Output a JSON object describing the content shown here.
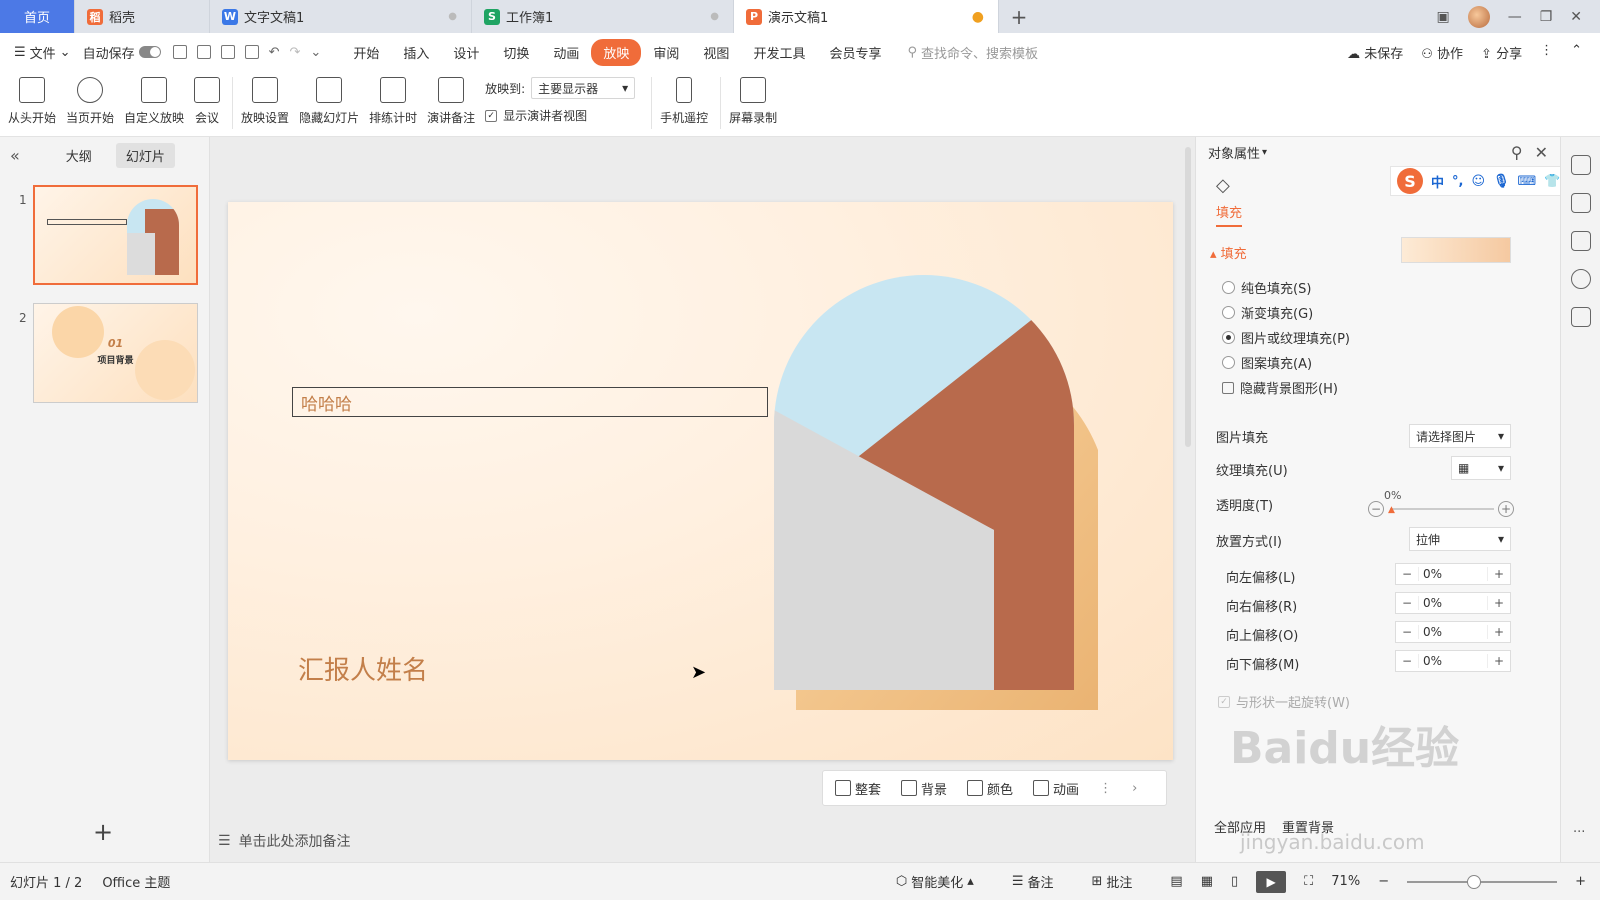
{
  "tabs": [
    {
      "label": "首页",
      "icon": "home"
    },
    {
      "label": "稻壳",
      "icon": "daoke-icon",
      "color": "#f06c3a"
    },
    {
      "label": "文字文稿1",
      "icon": "writer-icon",
      "color": "#3b78e7"
    },
    {
      "label": "工作簿1",
      "icon": "sheet-icon",
      "color": "#1fa463"
    },
    {
      "label": "演示文稿1",
      "icon": "presentation-icon",
      "color": "#f06c3a"
    }
  ],
  "menubar": {
    "file": "文件",
    "autosave": "自动保存",
    "tabs": [
      "开始",
      "插入",
      "设计",
      "切换",
      "动画",
      "放映",
      "审阅",
      "视图",
      "开发工具",
      "会员专享"
    ],
    "active_tab": "放映",
    "search_placeholder": "查找命令、搜索模板",
    "unsaved": "未保存",
    "collab": "协作",
    "share": "分享"
  },
  "ribbon": {
    "from_start": "从头开始",
    "from_current": "当页开始",
    "custom_show": "自定义放映",
    "meeting": "会议",
    "show_settings": "放映设置",
    "hide_slide": "隐藏幻灯片",
    "rehearse": "排练计时",
    "speaker_notes": "演讲备注",
    "play_to_label": "放映到:",
    "play_to_value": "主要显示器",
    "presenter_view": "显示演讲者视图",
    "phone_remote": "手机遥控",
    "screen_record": "屏幕录制"
  },
  "left_panel": {
    "tab_outline": "大纲",
    "tab_slides": "幻灯片",
    "slide_numbers": [
      "1",
      "2"
    ],
    "slide2_num": "01",
    "slide2_title": "项目背景"
  },
  "slide": {
    "title_text": "哈哈哈",
    "reporter": "汇报人姓名"
  },
  "float_toolbar": {
    "design": "整套",
    "background": "背景",
    "color": "颜色",
    "animation": "动画"
  },
  "notes_placeholder": "单击此处添加备注",
  "right_panel": {
    "title": "对象属性",
    "fill_tab": "填充",
    "section": "填充",
    "options": [
      {
        "label": "纯色填充(S)",
        "checked": false
      },
      {
        "label": "渐变填充(G)",
        "checked": false
      },
      {
        "label": "图片或纹理填充(P)",
        "checked": true
      },
      {
        "label": "图案填充(A)",
        "checked": false
      }
    ],
    "hide_bg": "隐藏背景图形(H)",
    "picture_fill_label": "图片填充",
    "picture_fill_value": "请选择图片",
    "texture_fill_label": "纹理填充(U)",
    "transparency_label": "透明度(T)",
    "transparency_value": "0%",
    "placement_label": "放置方式(I)",
    "placement_value": "拉伸",
    "offsets": [
      {
        "label": "向左偏移(L)",
        "value": "0%"
      },
      {
        "label": "向右偏移(R)",
        "value": "0%"
      },
      {
        "label": "向上偏移(O)",
        "value": "0%"
      },
      {
        "label": "向下偏移(M)",
        "value": "0%"
      }
    ],
    "rotate_with_shape": "与形状一起旋转(W)",
    "apply_all": "全部应用",
    "reset_bg": "重置背景"
  },
  "ime": {
    "lang": "中"
  },
  "watermark": {
    "brand": "Baidu经验",
    "url": "jingyan.baidu.com"
  },
  "status": {
    "slide_counter": "幻灯片 1 / 2",
    "theme": "Office 主题",
    "smart_beautify": "智能美化",
    "notes": "备注",
    "comments": "批注",
    "zoom": "71%"
  },
  "colors": {
    "accent": "#f06c3a",
    "slide_text": "#c37f4a",
    "sky": "#c8e6f2",
    "brick": "#b86a4c"
  }
}
